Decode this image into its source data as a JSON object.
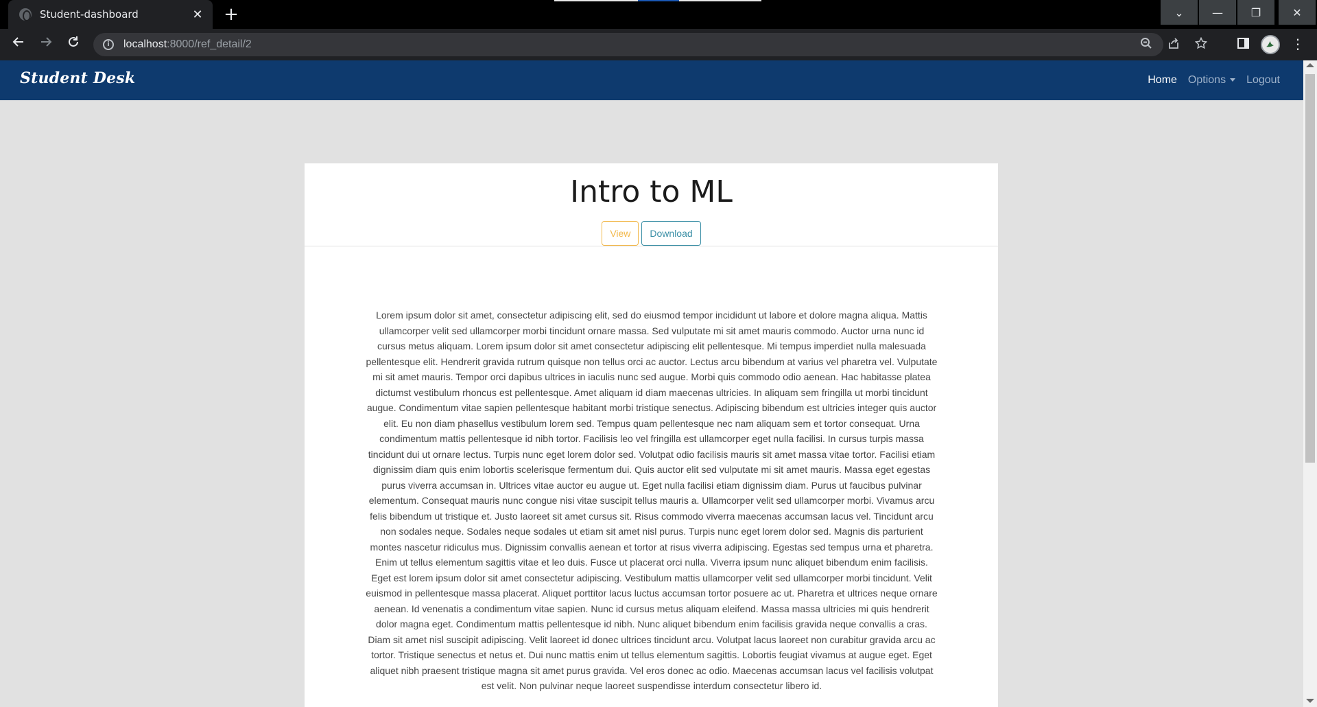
{
  "browser": {
    "tab_title": "Student-dashboard",
    "tab_close": "✕",
    "new_tab": "+",
    "url_host": "localhost",
    "url_path": ":8000/ref_detail/2",
    "window_controls": {
      "dropdown": "⌄",
      "minimize": "—",
      "restore": "❐",
      "close": "✕"
    },
    "icons": [
      "back-icon",
      "forward-icon",
      "reload-icon",
      "info-icon",
      "zoom-icon",
      "share-icon",
      "star-icon",
      "side-panel-icon",
      "profile-avatar",
      "menu-icon"
    ]
  },
  "navbar": {
    "brand": "Student Desk",
    "links": {
      "home": "Home",
      "options": "Options",
      "logout": "Logout"
    },
    "background_color": "#0e3a6e"
  },
  "card": {
    "title": "Intro to ML",
    "view_label": "View",
    "download_label": "Download",
    "view_color": "#f2b84b",
    "download_color": "#3b8fa6",
    "body": "Lorem ipsum dolor sit amet, consectetur adipiscing elit, sed do eiusmod tempor incididunt ut labore et dolore magna aliqua. Mattis ullamcorper velit sed ullamcorper morbi tincidunt ornare massa. Sed vulputate mi sit amet mauris commodo. Auctor urna nunc id cursus metus aliquam. Lorem ipsum dolor sit amet consectetur adipiscing elit pellentesque. Mi tempus imperdiet nulla malesuada pellentesque elit. Hendrerit gravida rutrum quisque non tellus orci ac auctor. Lectus arcu bibendum at varius vel pharetra vel. Vulputate mi sit amet mauris. Tempor orci dapibus ultrices in iaculis nunc sed augue. Morbi quis commodo odio aenean. Hac habitasse platea dictumst vestibulum rhoncus est pellentesque. Amet aliquam id diam maecenas ultricies. In aliquam sem fringilla ut morbi tincidunt augue. Condimentum vitae sapien pellentesque habitant morbi tristique senectus. Adipiscing bibendum est ultricies integer quis auctor elit. Eu non diam phasellus vestibulum lorem sed. Tempus quam pellentesque nec nam aliquam sem et tortor consequat. Urna condimentum mattis pellentesque id nibh tortor. Facilisis leo vel fringilla est ullamcorper eget nulla facilisi. In cursus turpis massa tincidunt dui ut ornare lectus. Turpis nunc eget lorem dolor sed. Volutpat odio facilisis mauris sit amet massa vitae tortor. Facilisi etiam dignissim diam quis enim lobortis scelerisque fermentum dui. Quis auctor elit sed vulputate mi sit amet mauris. Massa eget egestas purus viverra accumsan in. Ultrices vitae auctor eu augue ut. Eget nulla facilisi etiam dignissim diam. Purus ut faucibus pulvinar elementum. Consequat mauris nunc congue nisi vitae suscipit tellus mauris a. Ullamcorper velit sed ullamcorper morbi. Vivamus arcu felis bibendum ut tristique et. Justo laoreet sit amet cursus sit. Risus commodo viverra maecenas accumsan lacus vel. Tincidunt arcu non sodales neque. Sodales neque sodales ut etiam sit amet nisl purus. Turpis nunc eget lorem dolor sed. Magnis dis parturient montes nascetur ridiculus mus. Dignissim convallis aenean et tortor at risus viverra adipiscing. Egestas sed tempus urna et pharetra. Enim ut tellus elementum sagittis vitae et leo duis. Fusce ut placerat orci nulla. Viverra ipsum nunc aliquet bibendum enim facilisis. Eget est lorem ipsum dolor sit amet consectetur adipiscing. Vestibulum mattis ullamcorper velit sed ullamcorper morbi tincidunt. Velit euismod in pellentesque massa placerat. Aliquet porttitor lacus luctus accumsan tortor posuere ac ut. Pharetra et ultrices neque ornare aenean. Id venenatis a condimentum vitae sapien. Nunc id cursus metus aliquam eleifend. Massa massa ultricies mi quis hendrerit dolor magna eget. Condimentum mattis pellentesque id nibh. Nunc aliquet bibendum enim facilisis gravida neque convallis a cras. Diam sit amet nisl suscipit adipiscing. Velit laoreet id donec ultrices tincidunt arcu. Volutpat lacus laoreet non curabitur gravida arcu ac tortor. Tristique senectus et netus et. Dui nunc mattis enim ut tellus elementum sagittis. Lobortis feugiat vivamus at augue eget. Eget aliquet nibh praesent tristique magna sit amet purus gravida. Vel eros donec ac odio. Maecenas accumsan lacus vel facilisis volutpat est velit. Non pulvinar neque laoreet suspendisse interdum consectetur libero id."
  }
}
